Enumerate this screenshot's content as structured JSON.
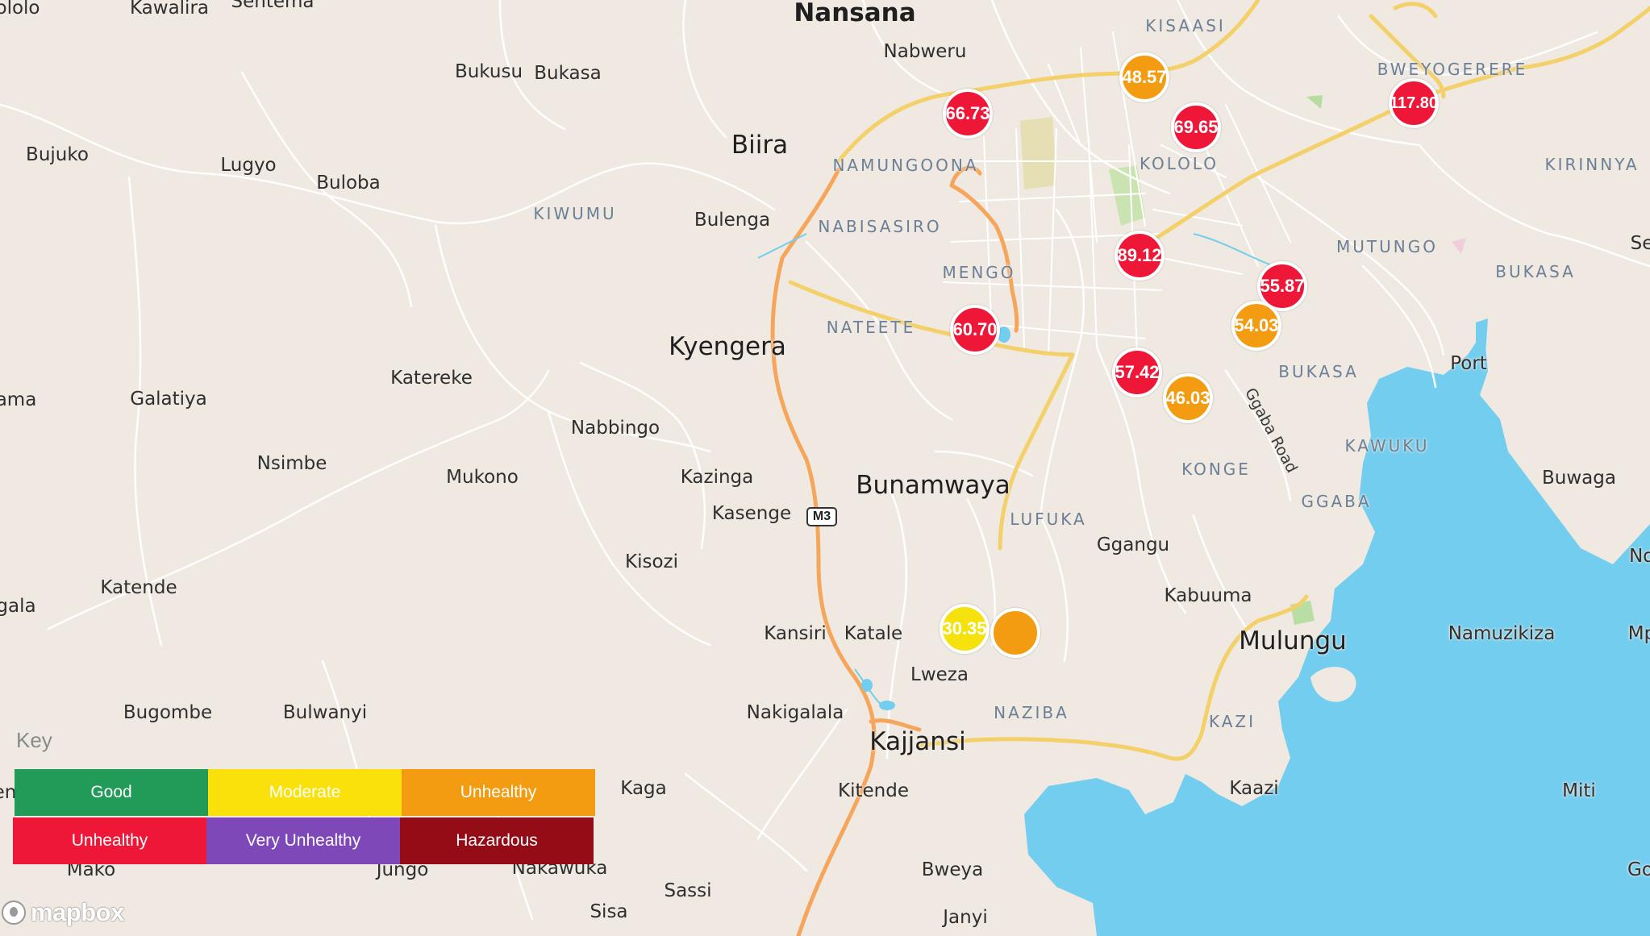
{
  "map": {
    "places": [
      {
        "name": "Nansana",
        "kind": "city bold"
      },
      {
        "name": "Kawalira",
        "kind": "town"
      },
      {
        "name": "Sentema",
        "kind": "town"
      },
      {
        "name": "ololo",
        "kind": "town"
      },
      {
        "name": "Nabweru",
        "kind": "town"
      },
      {
        "name": "KISAASI",
        "kind": "hood"
      },
      {
        "name": "BWEYOGERERE",
        "kind": "hood"
      },
      {
        "name": "Bukusu",
        "kind": "town"
      },
      {
        "name": "Bukasa",
        "kind": "town"
      },
      {
        "name": "Biira",
        "kind": "city"
      },
      {
        "name": "NAMUNGOONA",
        "kind": "hood"
      },
      {
        "name": "KOLOLO",
        "kind": "hood"
      },
      {
        "name": "KIRINNYA",
        "kind": "hood"
      },
      {
        "name": "Bujuko",
        "kind": "town"
      },
      {
        "name": "Lugyo",
        "kind": "town"
      },
      {
        "name": "Buloba",
        "kind": "town"
      },
      {
        "name": "KIWUMU",
        "kind": "hood"
      },
      {
        "name": "Bulenga",
        "kind": "town"
      },
      {
        "name": "NABISASIRO",
        "kind": "hood"
      },
      {
        "name": "MUTUNGO",
        "kind": "hood"
      },
      {
        "name": "BUKASA",
        "kind": "hood"
      },
      {
        "name": "Se",
        "kind": "town"
      },
      {
        "name": "MENGO",
        "kind": "hood"
      },
      {
        "name": "NATEETE",
        "kind": "hood"
      },
      {
        "name": "Kyengera",
        "kind": "city"
      },
      {
        "name": "Port",
        "kind": "town"
      },
      {
        "name": "ama",
        "kind": "town"
      },
      {
        "name": "Galatiya",
        "kind": "town"
      },
      {
        "name": "Katereke",
        "kind": "town"
      },
      {
        "name": "BUKASA",
        "kind": "hood"
      },
      {
        "name": "Nabbingo",
        "kind": "town"
      },
      {
        "name": "KAWUKU",
        "kind": "hood"
      },
      {
        "name": "Nsimbe",
        "kind": "town"
      },
      {
        "name": "Mukono",
        "kind": "town"
      },
      {
        "name": "Kazinga",
        "kind": "town"
      },
      {
        "name": "KONGE",
        "kind": "hood"
      },
      {
        "name": "Bunamwaya",
        "kind": "city"
      },
      {
        "name": "Buwaga",
        "kind": "town"
      },
      {
        "name": "GGABA",
        "kind": "hood"
      },
      {
        "name": "Kasenge",
        "kind": "town"
      },
      {
        "name": "LUFUKA",
        "kind": "hood"
      },
      {
        "name": "Ggangu",
        "kind": "town"
      },
      {
        "name": "Kisozi",
        "kind": "town"
      },
      {
        "name": "Nd",
        "kind": "town"
      },
      {
        "name": "Katende",
        "kind": "town"
      },
      {
        "name": "Kabuuma",
        "kind": "town"
      },
      {
        "name": "gala",
        "kind": "town"
      },
      {
        "name": "Kansiri",
        "kind": "town"
      },
      {
        "name": "Katale",
        "kind": "town"
      },
      {
        "name": "Mulungu",
        "kind": "city"
      },
      {
        "name": "Namuzikiza",
        "kind": "town"
      },
      {
        "name": "Mp",
        "kind": "town"
      },
      {
        "name": "Lweza",
        "kind": "town"
      },
      {
        "name": "Bugombe",
        "kind": "town"
      },
      {
        "name": "Bulwanyi",
        "kind": "town"
      },
      {
        "name": "Nakigalala",
        "kind": "town"
      },
      {
        "name": "NAZIBA",
        "kind": "hood"
      },
      {
        "name": "KAZI",
        "kind": "hood"
      },
      {
        "name": "Kajjansi",
        "kind": "city"
      },
      {
        "name": "Kaga",
        "kind": "town"
      },
      {
        "name": "Kitende",
        "kind": "town"
      },
      {
        "name": "Kaazi",
        "kind": "town"
      },
      {
        "name": "Miti",
        "kind": "town"
      },
      {
        "name": "Mako",
        "kind": "town"
      },
      {
        "name": "Jungo",
        "kind": "town"
      },
      {
        "name": "Nakawuka",
        "kind": "town"
      },
      {
        "name": "Bweya",
        "kind": "town"
      },
      {
        "name": "Go",
        "kind": "town"
      },
      {
        "name": "Sassi",
        "kind": "town"
      },
      {
        "name": "Sisa",
        "kind": "town"
      },
      {
        "name": "Janyi",
        "kind": "town"
      },
      {
        "name": "en",
        "kind": "town"
      },
      {
        "name": "Ggaba Road",
        "kind": "road"
      }
    ],
    "road_shield": "M3",
    "markers": [
      {
        "value": "48.57",
        "category": "unhealthy-sensitive",
        "color": "#f39c12"
      },
      {
        "value": "66.73",
        "category": "unhealthy",
        "color": "#ef1738"
      },
      {
        "value": "69.65",
        "category": "unhealthy",
        "color": "#ef1738"
      },
      {
        "value": "117.80",
        "category": "unhealthy",
        "color": "#ef1738"
      },
      {
        "value": "89.12",
        "category": "unhealthy",
        "color": "#ef1738"
      },
      {
        "value": "55.87",
        "category": "unhealthy",
        "color": "#ef1738"
      },
      {
        "value": "54.03",
        "category": "unhealthy-sensitive",
        "color": "#f39c12"
      },
      {
        "value": "60.70",
        "category": "unhealthy",
        "color": "#ef1738"
      },
      {
        "value": "57.42",
        "category": "unhealthy",
        "color": "#ef1738"
      },
      {
        "value": "46.03",
        "category": "unhealthy-sensitive",
        "color": "#f39c12"
      },
      {
        "value": "30.35",
        "category": "moderate",
        "color": "#f5e10c"
      },
      {
        "value": "",
        "category": "unhealthy-sensitive",
        "color": "#f39c12"
      }
    ]
  },
  "legend": {
    "title": "Key",
    "items": [
      {
        "label": "Good",
        "color": "#219b57"
      },
      {
        "label": "Moderate",
        "color": "#fbe10b"
      },
      {
        "label": "Unhealthy",
        "color": "#f39c12"
      },
      {
        "label": "Unhealthy",
        "color": "#ef1738"
      },
      {
        "label": "Very Unhealthy",
        "color": "#7e48b8"
      },
      {
        "label": "Hazardous",
        "color": "#940c16"
      }
    ]
  },
  "attribution": {
    "logo_text": "mapbox"
  }
}
